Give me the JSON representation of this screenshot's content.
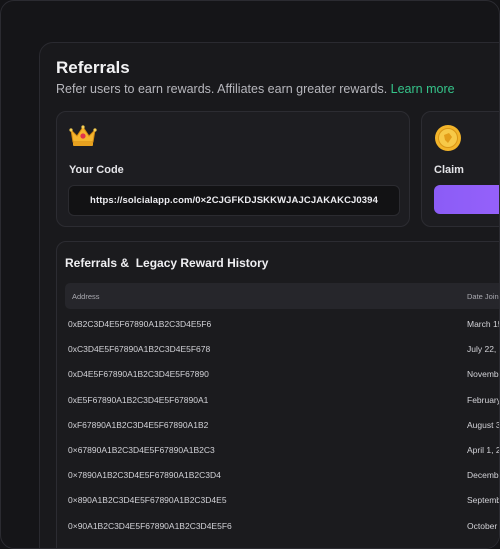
{
  "page": {
    "title": "Referrals",
    "subtitle": "Refer users to earn rewards. Affiliates earn greater rewards.",
    "learn_more": "Learn more"
  },
  "code_card": {
    "icon": "crown-icon",
    "label": "Your Code",
    "url": "https://solcialapp.com/0×2CJGFKDJSKKWJAJCJAKAKCJ0394"
  },
  "claim_card": {
    "icon": "coin-icon",
    "label": "Claim"
  },
  "history": {
    "title": "Referrals &  Legacy Reward History",
    "columns": [
      "Address",
      "Date Joine"
    ],
    "rows": [
      {
        "address": "0xB2C3D4E5F67890A1B2C3D4E5F6",
        "date": "March 15"
      },
      {
        "address": "0xC3D4E5F67890A1B2C3D4E5F678",
        "date": "July 22,"
      },
      {
        "address": "0xD4E5F67890A1B2C3D4E5F67890",
        "date": "Novemb"
      },
      {
        "address": "0xE5F67890A1B2C3D4E5F67890A1",
        "date": "February"
      },
      {
        "address": "0xF67890A1B2C3D4E5F67890A1B2",
        "date": "August 3"
      },
      {
        "address": "0×67890A1B2C3D4E5F67890A1B2C3",
        "date": "April 1, 2"
      },
      {
        "address": "0×7890A1B2C3D4E5F67890A1B2C3D4",
        "date": "Decemb"
      },
      {
        "address": "0×890A1B2C3D4E5F67890A1B2C3D4E5",
        "date": "Septemb"
      },
      {
        "address": "0×90A1B2C3D4E5F67890A1B2C3D4E5F6",
        "date": "October"
      }
    ]
  },
  "colors": {
    "background": "#151518",
    "accent_green": "#35c48a",
    "claim_purple": "#8b5cf6"
  }
}
